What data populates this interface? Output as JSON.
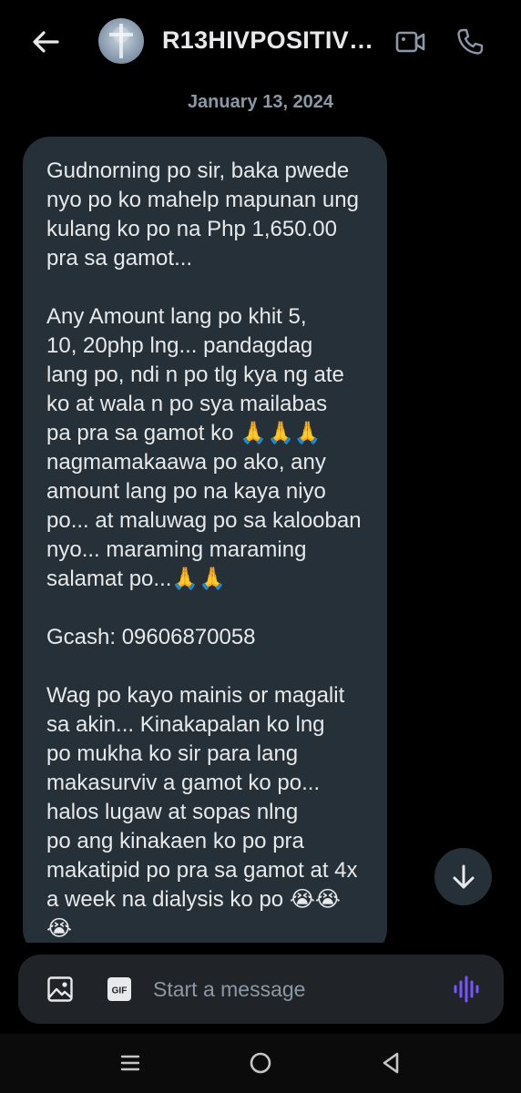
{
  "header": {
    "contact_name": "R13HIVPOSITIVE...",
    "back_icon": "arrow-left-icon",
    "video_icon": "video-camera-icon",
    "call_icon": "phone-icon"
  },
  "conversation": {
    "date": "January 13, 2024",
    "message": {
      "paragraph1": "Gudnorning po sir, baka pwede\nnyo po ko mahelp mapunan ung\nkulang ko po na Php 1,650.00\npra sa gamot...",
      "paragraph2": "Any Amount lang po khit 5,\n10, 20php lng... pandagdag\nlang po, ndi n po tlg kya ng ate\nko at wala n po sya mailabas\npa pra sa gamot ko 🙏🙏🙏\nnagmamakaawa po ako, any\namount lang po na kaya niyo\npo... at maluwag po sa kalooban\nnyo... maraming maraming\nsalamat po...🙏🙏",
      "paragraph3": "Gcash: 09606870058",
      "paragraph4": "Wag po kayo mainis or magalit\nsa akin... Kinakapalan ko lng\npo mukha ko sir para lang\nmakasurviv a gamot ko po...\nhalos lugaw at sopas nlng\npo ang kinakaen ko po pra\nmakatipid po pra sa gamot at 4x\na week na dialysis ko po 😭😭\n😭"
    },
    "scroll_icon": "arrow-down-icon"
  },
  "composer": {
    "placeholder": "Start a message",
    "image_icon": "image-icon",
    "gif_label": "GIF",
    "voice_icon": "voice-waveform-icon"
  },
  "navbar": {
    "menu_icon": "recent-apps-icon",
    "home_icon": "home-circle-icon",
    "back_icon": "back-triangle-icon"
  },
  "colors": {
    "background": "#000000",
    "bubble": "#253039",
    "composer": "#202327",
    "text": "#e7e9ea",
    "muted": "#8b98a5",
    "accent": "#7856ff"
  }
}
